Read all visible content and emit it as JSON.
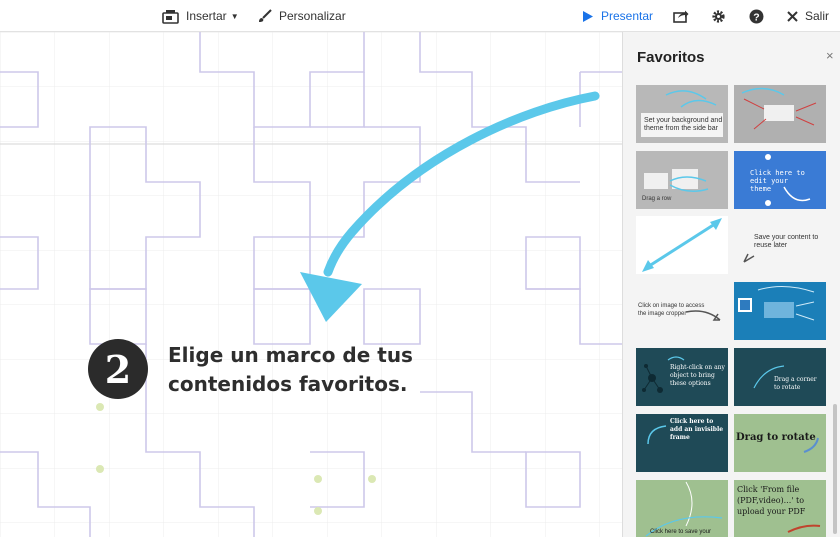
{
  "toolbar": {
    "insert_label": "Insertar",
    "customize_label": "Personalizar",
    "present_label": "Presentar",
    "exit_label": "Salir",
    "accent_color": "#1a73e8"
  },
  "canvas": {
    "step_number": "2",
    "step_text": "Elige un marco de tus contenidos favoritos.",
    "arrow_color": "#5bc8ea",
    "outline_color": "#cdc8ea"
  },
  "favorites": {
    "title": "Favoritos",
    "close_label": "×",
    "thumbnails": [
      {
        "caption": "Set your background and theme from the side bar"
      },
      {
        "caption": ""
      },
      {
        "caption": "Drag a row"
      },
      {
        "caption": "Click here to edit your theme"
      },
      {
        "caption": ""
      },
      {
        "caption": "Save your content to reuse later"
      },
      {
        "caption": "Click on image to access the image cropper"
      },
      {
        "caption": ""
      },
      {
        "caption": "Right-click on any object to bring these options"
      },
      {
        "caption": "Drag a corner to rotate"
      },
      {
        "caption": "Click here to add an invisible frame"
      },
      {
        "caption": "Drag to rotate"
      },
      {
        "caption": "Click here to save your theme"
      },
      {
        "caption": "Click 'From file (PDF,video)...' to upload your PDF"
      }
    ]
  }
}
